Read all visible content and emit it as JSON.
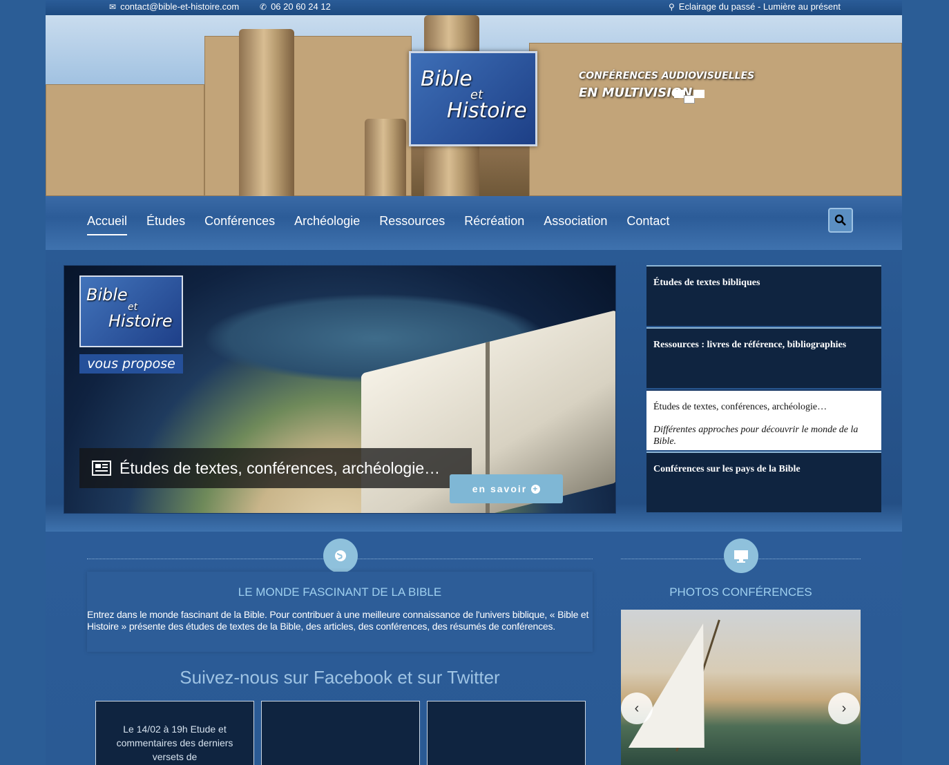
{
  "topbar": {
    "email": "contact@bible-et-histoire.com",
    "phone": "06 20 60 24 12",
    "tagline": "Eclairage du passé - Lumière au présent"
  },
  "banner": {
    "logo_line1": "Bible",
    "logo_line2": "et",
    "logo_line3": "Histoire",
    "conf_line1": "CONFÉRENCES AUDIOVISUELLES",
    "conf_line2": "EN MULTIVISION"
  },
  "nav": {
    "items": [
      "Accueil",
      "Études",
      "Conférences",
      "Archéologie",
      "Ressources",
      "Récréation",
      "Association",
      "Contact"
    ],
    "active": "Accueil"
  },
  "slider": {
    "mini_logo_line1": "Bible",
    "mini_logo_line2": "et",
    "mini_logo_line3": "Histoire",
    "vous_propose": "vous propose",
    "caption": "Études de textes, conférences, archéologie…",
    "button": "en savoir",
    "thumbs": [
      {
        "title": "Études de textes bibliques"
      },
      {
        "title": "Ressources : livres de référence, bibliographies"
      },
      {
        "title": "Études de textes, conférences, archéologie…",
        "subtitle": "Différentes approches pour découvrir le monde de la Bible."
      },
      {
        "title": "Conférences sur les pays de la Bible"
      }
    ]
  },
  "section_left": {
    "title": "LE MONDE FASCINANT DE LA BIBLE",
    "intro": "Entrez dans le monde fascinant de la Bible. Pour contribuer à une meilleure connaissance de l'univers biblique, « Bible et Histoire » présente des études de textes de la Bible, des articles, des conférences, des résumés de conférences.",
    "follow": "Suivez-nous sur Facebook et sur Twitter",
    "cards": [
      "Le 14/02 à 19h Etude et commentaires des derniers versets de",
      "",
      ""
    ]
  },
  "section_right": {
    "title": "PHOTOS CONFÉRENCES"
  }
}
